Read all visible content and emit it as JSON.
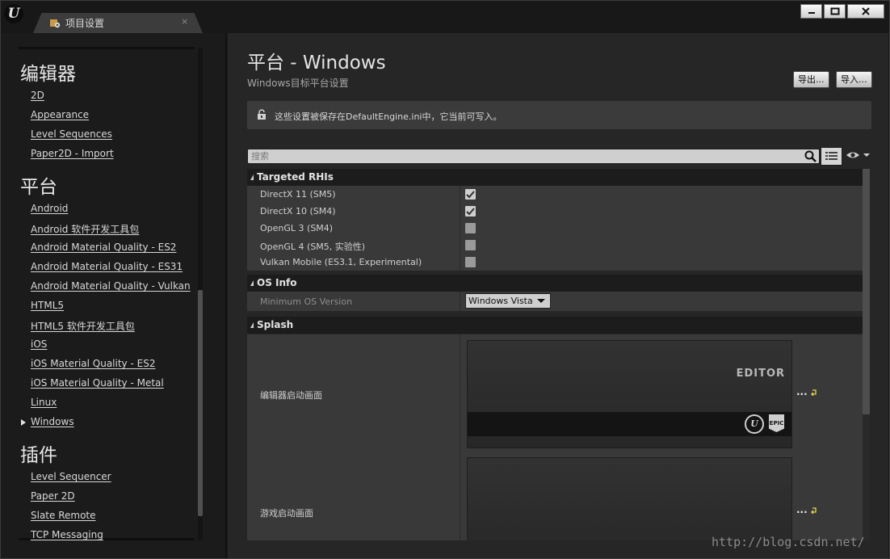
{
  "titlebar": {
    "tab_label": "项目设置",
    "tab_close": "×",
    "logo": "U",
    "minimize_icon": "minimize-icon",
    "maximize_icon": "maximize-icon",
    "close_icon": "close-icon"
  },
  "sidebar": {
    "sections": [
      {
        "header": "编辑器",
        "items": [
          "2D",
          "Appearance",
          "Level Sequences",
          "Paper2D - Import"
        ]
      },
      {
        "header": "平台",
        "items": [
          "Android",
          "Android 软件开发工具包",
          "Android Material Quality - ES2",
          "Android Material Quality - ES31",
          "Android Material Quality - Vulkan",
          "HTML5",
          "HTML5 软件开发工具包",
          "iOS",
          "iOS Material Quality - ES2",
          "iOS Material Quality - Metal",
          "Linux",
          "Windows"
        ],
        "selected": "Windows"
      },
      {
        "header": "插件",
        "items": [
          "Level Sequencer",
          "Paper 2D",
          "Slate Remote",
          "TCP Messaging"
        ]
      }
    ]
  },
  "main": {
    "title": "平台 - Windows",
    "subtitle": "Windows目标平台设置",
    "export_label": "导出...",
    "import_label": "导入...",
    "notice": "这些设置被保存在DefaultEngine.ini中，它当前可写入。",
    "search_placeholder": "搜索",
    "categories": {
      "rhi": {
        "title": "Targeted RHIs",
        "rows": [
          {
            "label": "DirectX 11 (SM5)",
            "checked": true
          },
          {
            "label": "DirectX 10 (SM4)",
            "checked": true
          },
          {
            "label": "OpenGL 3 (SM4)",
            "checked": false
          },
          {
            "label": "OpenGL 4 (SM5, 实验性)",
            "checked": false
          },
          {
            "label": "Vulkan Mobile (ES3.1, Experimental)",
            "checked": false
          }
        ]
      },
      "os": {
        "title": "OS Info",
        "min_os_label": "Minimum OS Version",
        "min_os_value": "Windows Vista"
      },
      "splash": {
        "title": "Splash",
        "editor_label": "编辑器启动画面",
        "editor_image_text": "EDITOR",
        "epic_logo_text": "EPIC",
        "ue_logo_text": "U",
        "game_label": "游戏启动画面",
        "dots": "..."
      }
    }
  },
  "watermark": "http://blog.csdn.net/"
}
